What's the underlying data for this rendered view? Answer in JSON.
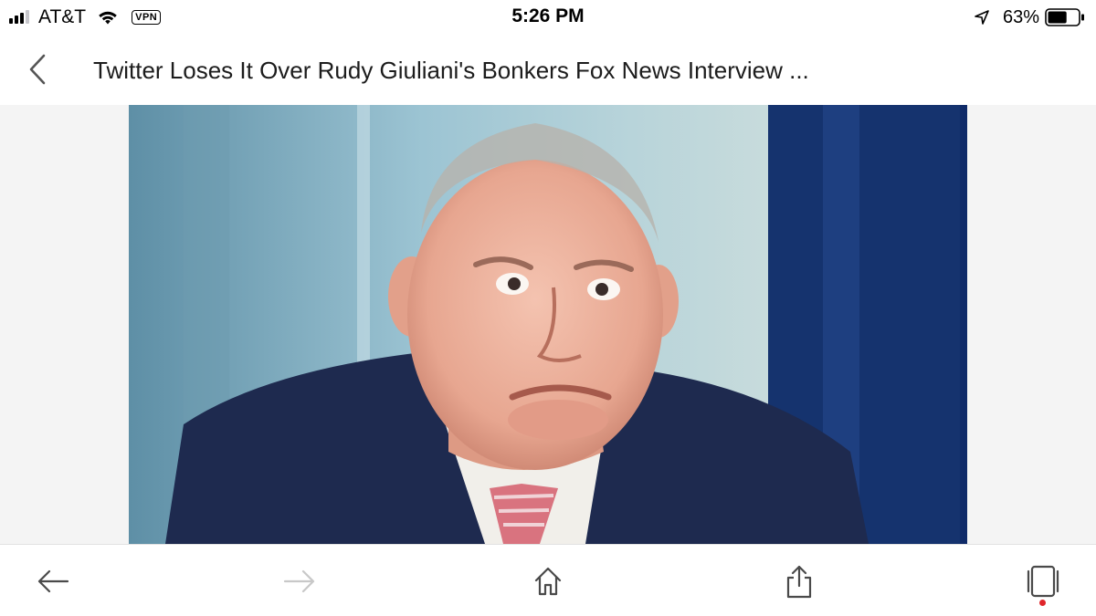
{
  "status_bar": {
    "carrier": "AT&T",
    "vpn": "VPN",
    "time": "5:26 PM",
    "battery": "63%",
    "battery_level": 0.63,
    "signal_bars_active": 3,
    "signal_bars_total": 4
  },
  "header": {
    "title": "Twitter Loses It Over Rudy Giuliani's Bonkers Fox News Interview ..."
  },
  "toolbar": {
    "icons": [
      "arrow-left-icon",
      "arrow-right-icon",
      "home-icon",
      "share-icon",
      "tabs-icon"
    ],
    "notification_color": "#e0262b"
  },
  "colors": {
    "accent": "#e0262b",
    "icon": "#4a4a4a",
    "icon_disabled": "#c8c8c8"
  }
}
